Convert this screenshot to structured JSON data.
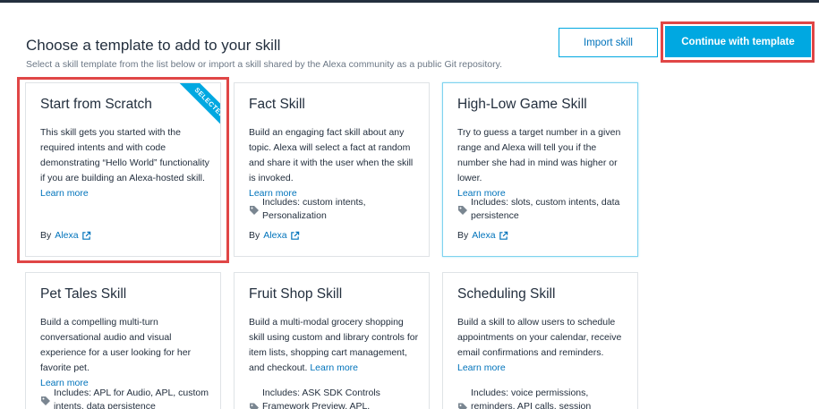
{
  "header": {
    "title": "Choose a template to add to your skill",
    "subtitle": "Select a skill template from the list below or import a skill shared by the Alexa community as a public Git repository.",
    "import_label": "Import skill",
    "continue_label": "Continue with template"
  },
  "colors": {
    "accent": "#00a8e1",
    "link": "#0073bb",
    "highlight": "#e04646",
    "text": "#232f3e"
  },
  "cards": [
    {
      "name": "Start from Scratch",
      "selected_label": "SELECTED",
      "description": "This skill gets you started with the required intents and with code demonstrating “Hello World” functionality if you are building an Alexa-hosted skill.",
      "learn_more": "Learn more",
      "includes": "",
      "by_label": "By",
      "author": "Alexa"
    },
    {
      "name": "Fact Skill",
      "description": "Build an engaging fact skill about any topic. Alexa will select a fact at random and share it with the user when the skill is invoked.",
      "learn_more": "Learn more",
      "includes": "Includes: custom intents, Personalization",
      "by_label": "By",
      "author": "Alexa"
    },
    {
      "name": "High-Low Game Skill",
      "description": "Try to guess a target number in a given range and Alexa will tell you if the number she had in mind was higher or lower.",
      "learn_more": "Learn more",
      "includes": "Includes: slots, custom intents, data persistence",
      "by_label": "By",
      "author": "Alexa"
    },
    {
      "name": "Pet Tales Skill",
      "description": "Build a compelling multi-turn conversational audio and visual experience for a user looking for her favorite pet.",
      "learn_more": "Learn more",
      "includes": "Includes: APL for Audio, APL, custom intents, data persistence"
    },
    {
      "name": "Fruit Shop Skill",
      "description": "Build a multi-modal grocery shopping skill using custom and library controls for item lists, shopping cart management, and checkout.",
      "learn_more": "Learn more",
      "includes": "Includes: ASK SDK Controls Framework Preview, APL, Personalization"
    },
    {
      "name": "Scheduling Skill",
      "description": "Build a skill to allow users to schedule appointments on your calendar, receive email confirmations and reminders.",
      "learn_more": "Learn more",
      "includes": "Includes: voice permissions, reminders, API calls, session persistence"
    }
  ]
}
